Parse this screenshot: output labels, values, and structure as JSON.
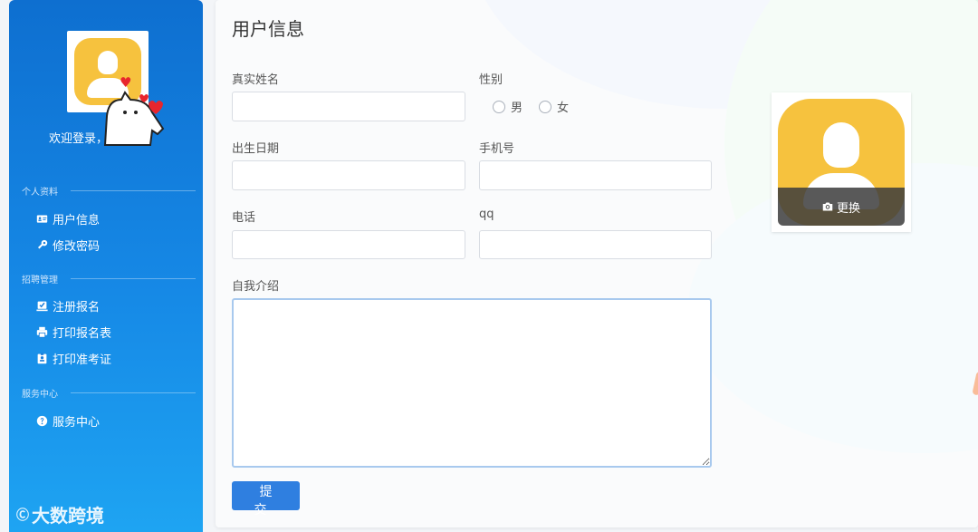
{
  "sidebar": {
    "welcome": "欢迎登录，",
    "sections": [
      {
        "title": "个人资料",
        "items": [
          {
            "label": "用户信息",
            "icon": "id-card-icon"
          },
          {
            "label": "修改密码",
            "icon": "key-icon"
          }
        ]
      },
      {
        "title": "招聘管理",
        "items": [
          {
            "label": "注册报名",
            "icon": "check-square-icon"
          },
          {
            "label": "打印报名表",
            "icon": "printer-icon"
          },
          {
            "label": "打印准考证",
            "icon": "badge-icon"
          }
        ]
      },
      {
        "title": "服务中心",
        "items": [
          {
            "label": "服务中心",
            "icon": "question-circle-icon"
          }
        ]
      }
    ],
    "watermark": "大数跨境",
    "watermark_mark": "Ⓒ"
  },
  "main": {
    "title": "用户信息",
    "fields": {
      "real_name": {
        "label": "真实姓名",
        "value": ""
      },
      "gender": {
        "label": "性别",
        "options": [
          "男",
          "女"
        ]
      },
      "birth_date": {
        "label": "出生日期",
        "value": ""
      },
      "mobile": {
        "label": "手机号",
        "value": ""
      },
      "phone": {
        "label": "电话",
        "value": ""
      },
      "qq": {
        "label": "qq",
        "value": ""
      },
      "intro": {
        "label": "自我介绍",
        "value": ""
      }
    },
    "submit_label": "提交",
    "photo": {
      "change_label": "更换"
    }
  },
  "colors": {
    "sidebar_top": "#0e6fd0",
    "sidebar_bottom": "#1ea4f2",
    "primary": "#2f7fe0",
    "avatar": "#f6c23e"
  }
}
